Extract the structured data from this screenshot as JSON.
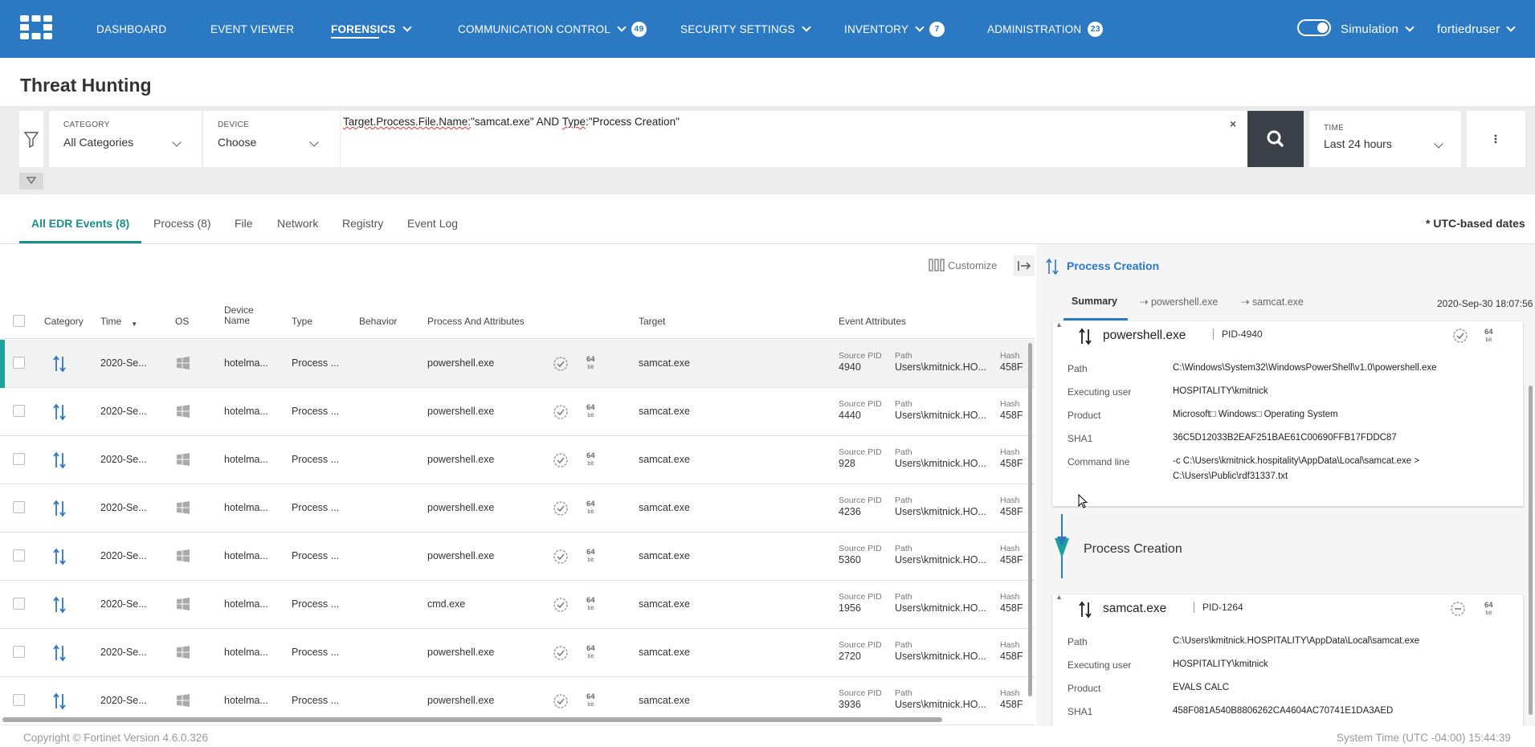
{
  "nav": {
    "items": [
      {
        "label": "DASHBOARD"
      },
      {
        "label": "EVENT VIEWER"
      },
      {
        "label": "FORENSICS"
      },
      {
        "label": "COMMUNICATION CONTROL",
        "badge": "49"
      },
      {
        "label": "SECURITY SETTINGS"
      },
      {
        "label": "INVENTORY",
        "badge": "7"
      },
      {
        "label": "ADMINISTRATION",
        "badge": "23"
      }
    ],
    "simulation_label": "Simulation",
    "user": "fortiedruser",
    "colors": {
      "bar": "#2b79c2",
      "accent": "#1a8f8a"
    }
  },
  "page": {
    "title": "Threat Hunting"
  },
  "filters": {
    "category_label": "CATEGORY",
    "category_value": "All Categories",
    "device_label": "DEVICE",
    "device_value": "Choose",
    "query": {
      "part1": "Target.Process.File.Name:",
      "part2": "\"samcat.exe\" AND ",
      "part3": "Type",
      "part4": ":\"Process Creation\""
    },
    "clear": "×",
    "time_label": "TIME",
    "time_value": "Last 24 hours"
  },
  "tabs": [
    {
      "label": "All EDR Events (8)"
    },
    {
      "label": "Process (8)"
    },
    {
      "label": "File"
    },
    {
      "label": "Network"
    },
    {
      "label": "Registry"
    },
    {
      "label": "Event Log"
    }
  ],
  "utc_note": "* UTC-based dates",
  "table": {
    "customize": "Customize",
    "headers": {
      "category": "Category",
      "time": "Time",
      "os": "OS",
      "device": "Device\nName",
      "type": "Type",
      "behavior": "Behavior",
      "process": "Process And Attributes",
      "target": "Target",
      "event_attributes": "Event Attributes"
    },
    "attr_labels": {
      "source_pid": "Source PID",
      "path": "Path",
      "hash": "Hash"
    },
    "bit": {
      "num": "64",
      "unit": "bit"
    },
    "rows": [
      {
        "time": "2020-Se...",
        "device": "hotelma...",
        "type": "Process ...",
        "process": "powershell.exe",
        "target": "samcat.exe",
        "pid": "4940",
        "path": "Users\\kmitnick.HO...",
        "hash": "458F"
      },
      {
        "time": "2020-Se...",
        "device": "hotelma...",
        "type": "Process ...",
        "process": "powershell.exe",
        "target": "samcat.exe",
        "pid": "4440",
        "path": "Users\\kmitnick.HO...",
        "hash": "458F"
      },
      {
        "time": "2020-Se...",
        "device": "hotelma...",
        "type": "Process ...",
        "process": "powershell.exe",
        "target": "samcat.exe",
        "pid": "928",
        "path": "Users\\kmitnick.HO...",
        "hash": "458F"
      },
      {
        "time": "2020-Se...",
        "device": "hotelma...",
        "type": "Process ...",
        "process": "powershell.exe",
        "target": "samcat.exe",
        "pid": "4236",
        "path": "Users\\kmitnick.HO...",
        "hash": "458F"
      },
      {
        "time": "2020-Se...",
        "device": "hotelma...",
        "type": "Process ...",
        "process": "powershell.exe",
        "target": "samcat.exe",
        "pid": "5360",
        "path": "Users\\kmitnick.HO...",
        "hash": "458F"
      },
      {
        "time": "2020-Se...",
        "device": "hotelma...",
        "type": "Process ...",
        "process": "cmd.exe",
        "target": "samcat.exe",
        "pid": "1956",
        "path": "Users\\kmitnick.HO...",
        "hash": "458F"
      },
      {
        "time": "2020-Se...",
        "device": "hotelma...",
        "type": "Process ...",
        "process": "powershell.exe",
        "target": "samcat.exe",
        "pid": "2720",
        "path": "Users\\kmitnick.HO...",
        "hash": "458F"
      },
      {
        "time": "2020-Se...",
        "device": "hotelma...",
        "type": "Process ...",
        "process": "powershell.exe",
        "target": "samcat.exe",
        "pid": "3936",
        "path": "Users\\kmitnick.HO...",
        "hash": "458F"
      }
    ]
  },
  "panel": {
    "title": "Process Creation",
    "tabs": [
      "Summary",
      "⇢ powershell.exe",
      "⇢ samcat.exe"
    ],
    "date": "2020-Sep-30 18:07:56",
    "labels": {
      "path": "Path",
      "user": "Executing user",
      "product": "Product",
      "sha1": "SHA1",
      "cmd": "Command line"
    },
    "source": {
      "name": "powershell.exe",
      "pid": "PID-4940",
      "path": "C:\\Windows\\System32\\WindowsPowerShell\\v1.0\\powershell.exe",
      "user": "HOSPITALITY\\kmitnick",
      "product": "Microsoft□ Windows□ Operating System",
      "sha1": "36C5D12033B2EAF251BAE61C00690FFB17FDDC87",
      "cmd_line1": "-c C:\\Users\\kmitnick.hospitality\\AppData\\Local\\samcat.exe >",
      "cmd_line2": "C:\\Users\\Public\\rdf31337.txt"
    },
    "flow_title": "Process Creation",
    "target": {
      "name": "samcat.exe",
      "pid": "PID-1264",
      "path": "C:\\Users\\kmitnick.HOSPITALITY\\AppData\\Local\\samcat.exe",
      "user": "HOSPITALITY\\kmitnick",
      "product": "EVALS CALC",
      "sha1": "458F081A540B8806262CA4604AC70741E1DA3AED"
    }
  },
  "footer": {
    "copyright": "Copyright © Fortinet Version 4.6.0.326",
    "system_time": "System Time (UTC -04:00) 15:44:39"
  }
}
